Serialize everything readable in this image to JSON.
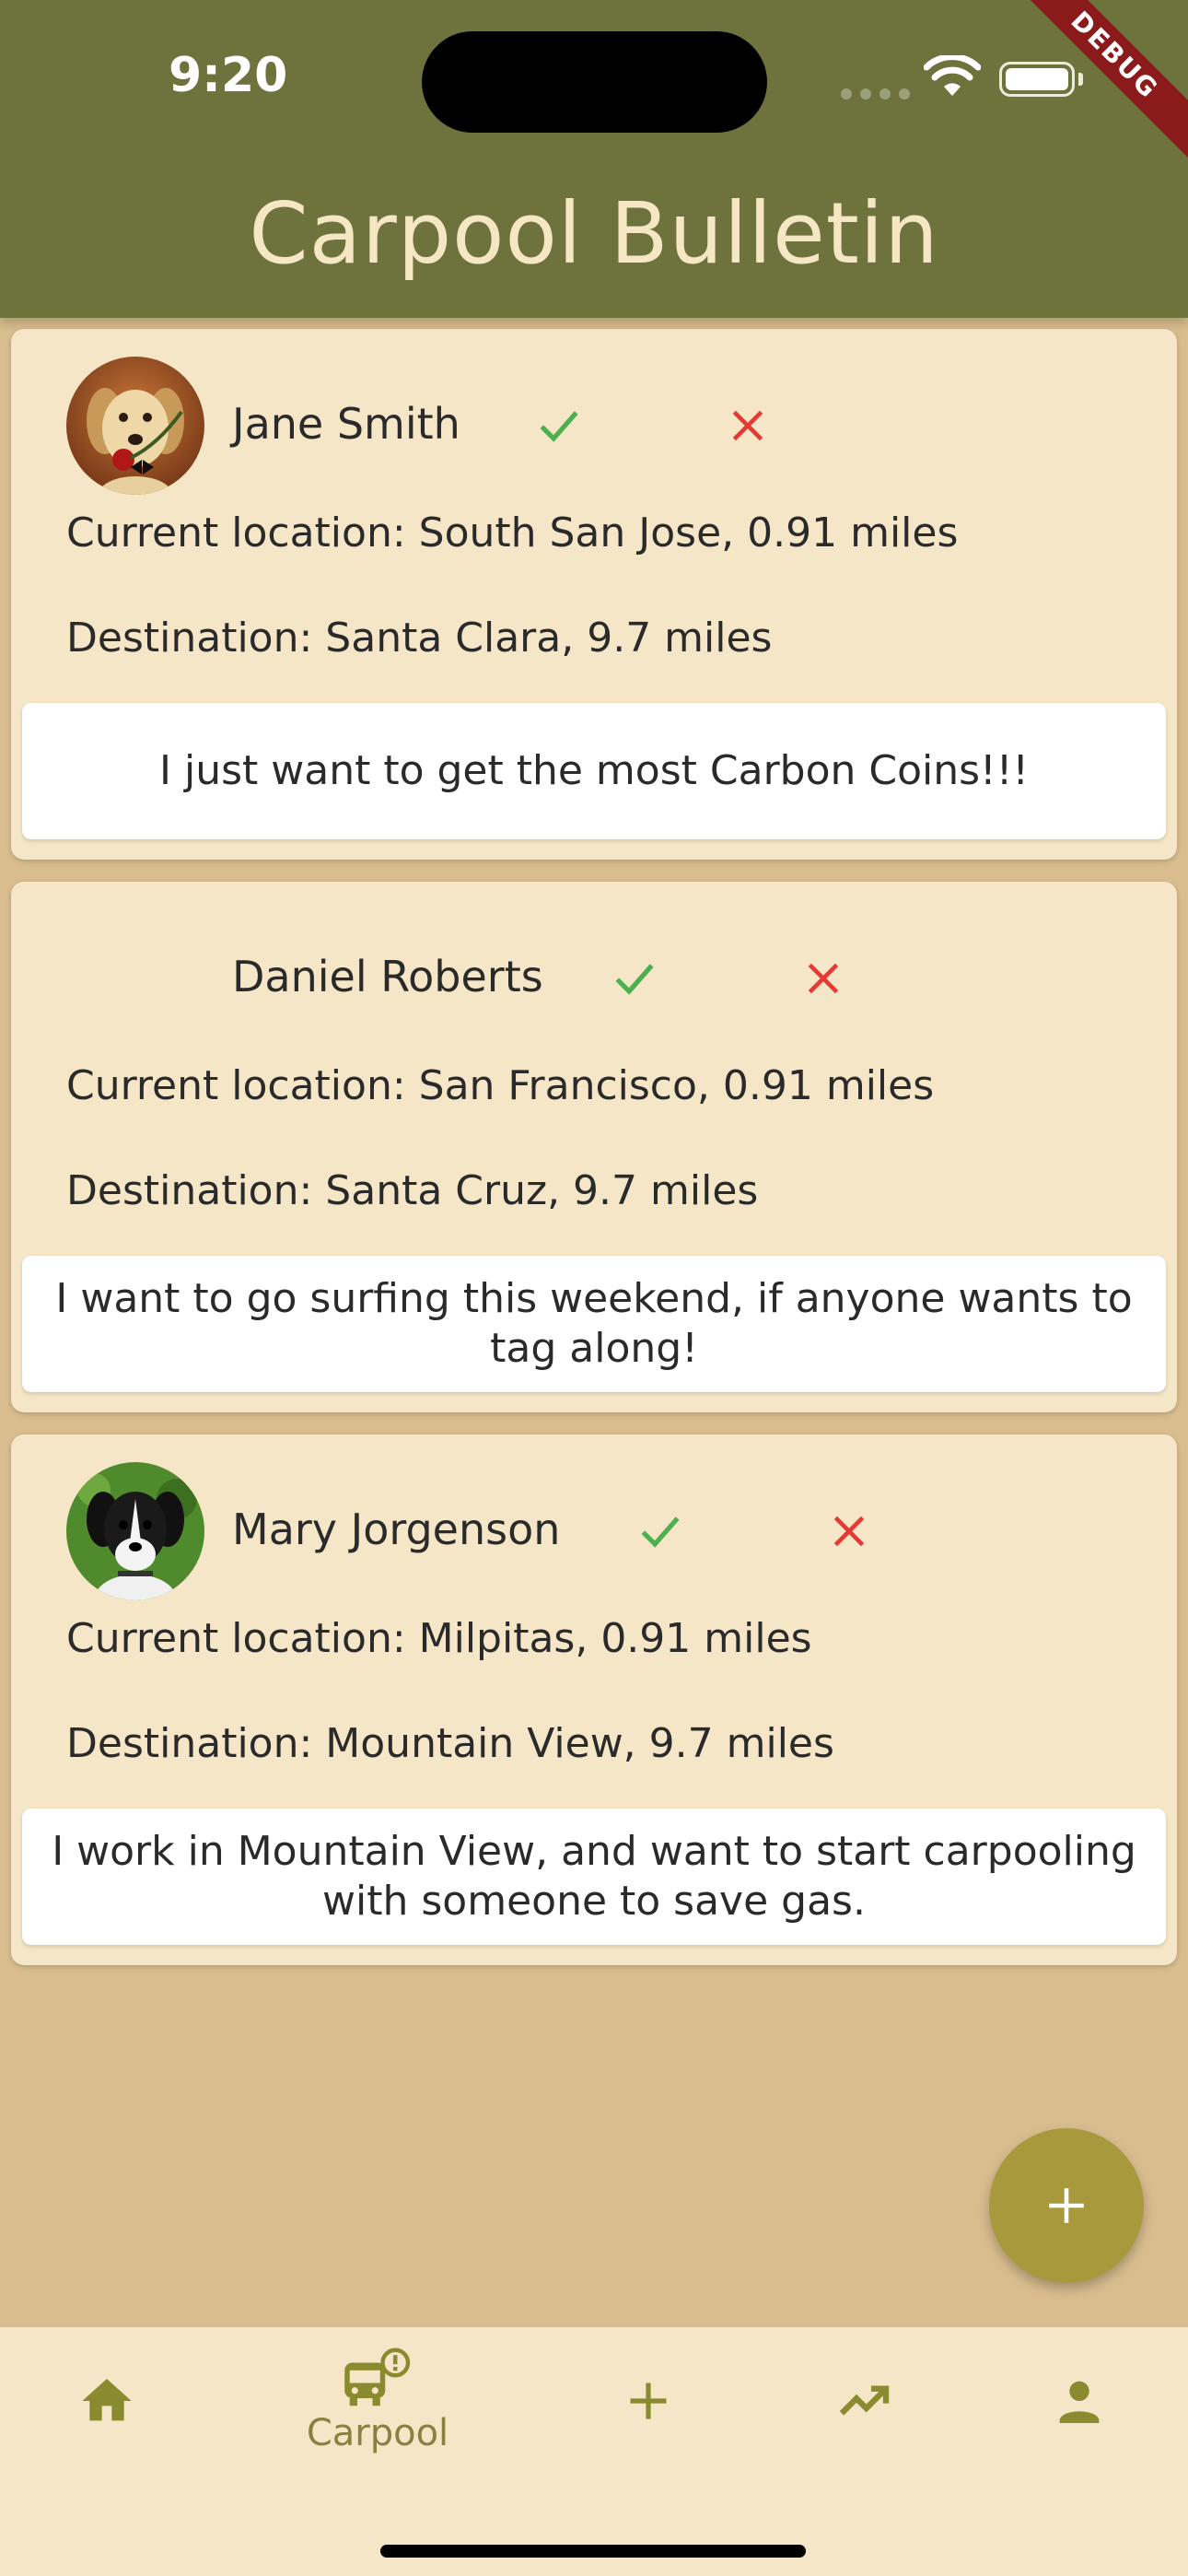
{
  "status_bar": {
    "time": "9:20",
    "debug_label": "DEBUG"
  },
  "app_bar": {
    "title": "Carpool Bulletin"
  },
  "posts": [
    {
      "name": "Jane Smith",
      "has_avatar": true,
      "avatar": "puppy-with-rose-photo",
      "current_location": "Current location: South San Jose, 0.91 miles",
      "destination": "Destination: Santa Clara, 9.7 miles",
      "message": "I just want to get the most Carbon Coins!!!"
    },
    {
      "name": "Daniel Roberts",
      "has_avatar": false,
      "current_location": "Current location: San Francisco, 0.91 miles",
      "destination": "Destination: Santa Cruz, 9.7 miles",
      "message": "I want to go surfing this weekend, if anyone wants to tag along!"
    },
    {
      "name": "Mary Jorgenson",
      "has_avatar": true,
      "avatar": "black-white-puppy-photo",
      "current_location": "Current location: Milpitas, 0.91 miles",
      "destination": "Destination: Mountain View, 9.7 miles",
      "message": "I work in Mountain View, and want to start carpooling with someone to save gas."
    }
  ],
  "fab": {
    "icon": "plus-icon"
  },
  "bottom_nav": {
    "items": [
      {
        "icon": "home-icon",
        "label": ""
      },
      {
        "icon": "bus-alert-icon",
        "label": "Carpool",
        "selected": true
      },
      {
        "icon": "plus-icon",
        "label": ""
      },
      {
        "icon": "trending-up-icon",
        "label": ""
      },
      {
        "icon": "person-icon",
        "label": ""
      }
    ]
  },
  "colors": {
    "app_bar": "#6e733e",
    "background": "#d9bd8f",
    "card": "#f5e6c8",
    "accept": "#4caf50",
    "reject": "#e53935",
    "accent": "#a89a3c"
  }
}
